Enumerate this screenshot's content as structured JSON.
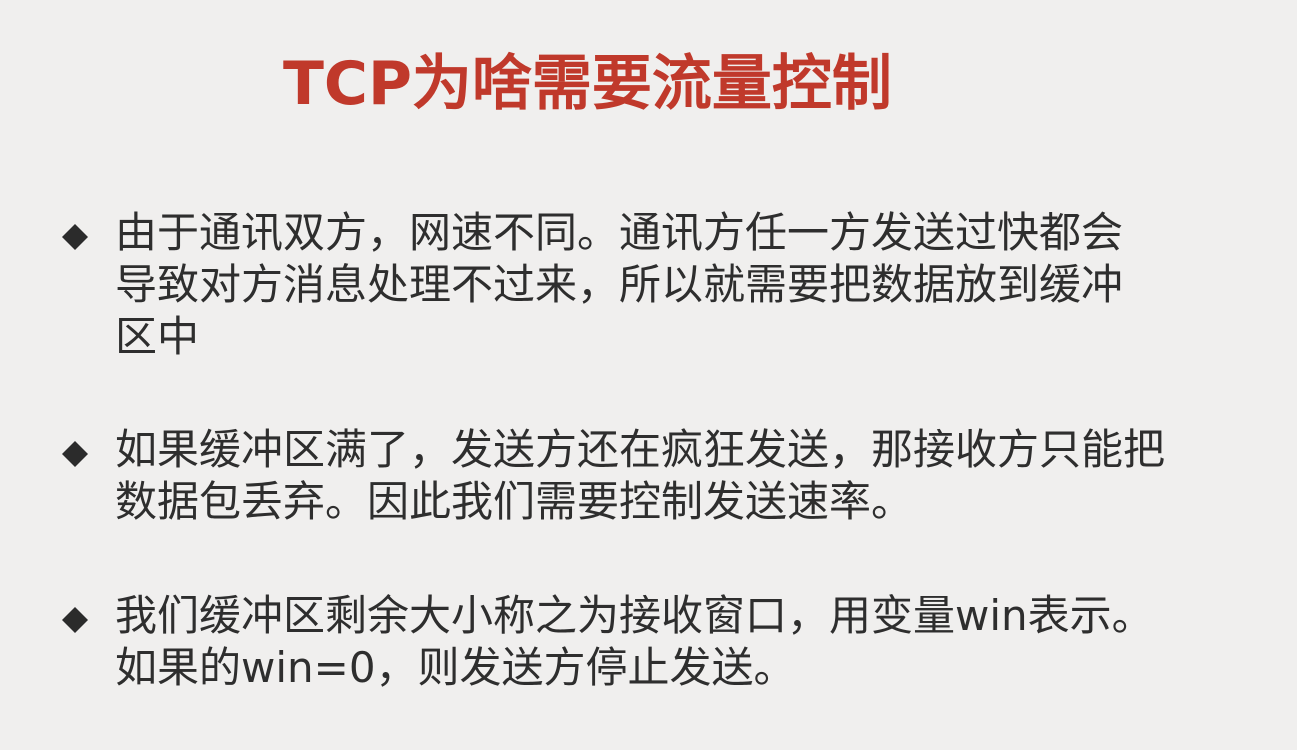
{
  "slide": {
    "title": "TCP为啥需要流量控制",
    "title_color": "#c0392b",
    "bullets": [
      {
        "icon": "diamond-bullet-icon",
        "lines": [
          "由于通讯双方，网速不同。通讯方任一方发送过快都会",
          "导致对方消息处理不过来，所以就需要把数据放到缓冲",
          "区中"
        ]
      },
      {
        "icon": "diamond-bullet-icon",
        "lines": [
          "如果缓冲区满了，发送方还在疯狂发送，那接收方只能把",
          "数据包丢弃。因此我们需要控制发送速率。"
        ]
      },
      {
        "icon": "diamond-bullet-icon",
        "lines": [
          "我们缓冲区剩余大小称之为接收窗口，用变量win表示。",
          "如果的win=0，则发送方停止发送。"
        ]
      }
    ]
  }
}
